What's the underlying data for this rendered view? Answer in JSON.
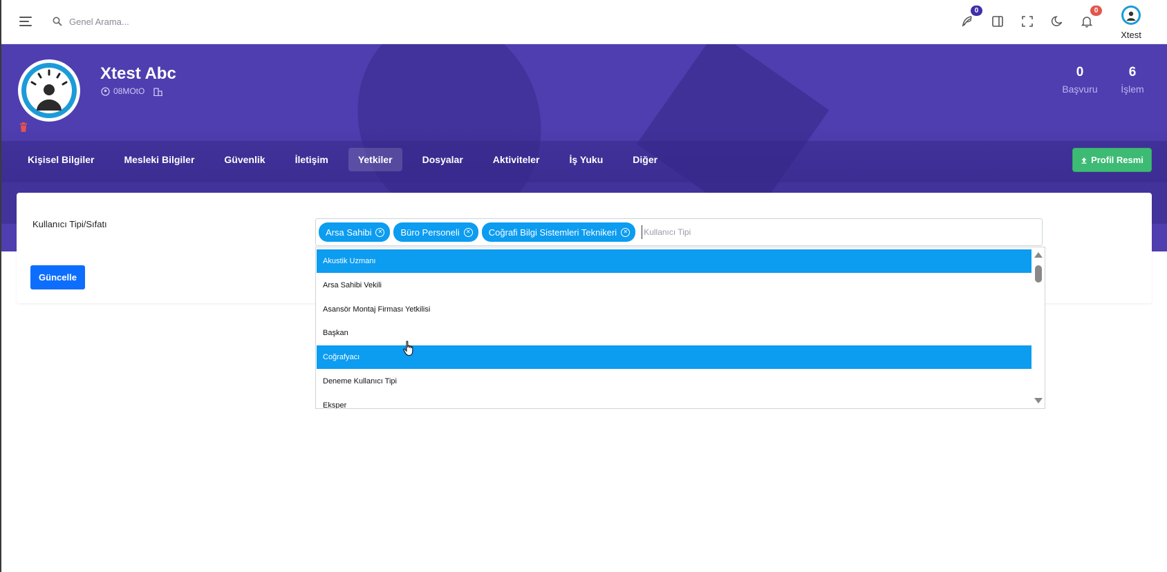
{
  "topbar": {
    "search_placeholder": "Genel Arama...",
    "messages_badge": "0",
    "notifications_badge": "0",
    "user_name": "Xtest"
  },
  "profile": {
    "name": "Xtest Abc",
    "code": "08MOtO",
    "stats": [
      {
        "value": "0",
        "label": "Başvuru"
      },
      {
        "value": "6",
        "label": "İşlem"
      }
    ]
  },
  "tabs": [
    {
      "label": "Kişisel Bilgiler"
    },
    {
      "label": "Mesleki Bilgiler"
    },
    {
      "label": "Güvenlik"
    },
    {
      "label": "İletişim"
    },
    {
      "label": "Yetkiler"
    },
    {
      "label": "Dosyalar"
    },
    {
      "label": "Aktiviteler"
    },
    {
      "label": "İş Yuku"
    },
    {
      "label": "Diğer"
    }
  ],
  "active_tab": "Yetkiler",
  "profile_button": "Profil Resmi",
  "form": {
    "label": "Kullanıcı Tipi/Sıfatı",
    "selected": [
      "Arsa Sahibi",
      "Büro Personeli",
      "Coğrafi Bilgi Sistemleri Teknikeri"
    ],
    "placeholder": "Kullanıcı Tipi",
    "options": [
      {
        "label": "Akustik Uzmanı",
        "highlighted": true
      },
      {
        "label": "Arsa Sahibi Vekili",
        "highlighted": false
      },
      {
        "label": "Asansör Montaj Firması Yetkilisi",
        "highlighted": false
      },
      {
        "label": "Başkan",
        "highlighted": false
      },
      {
        "label": "Coğrafyacı",
        "highlighted": true
      },
      {
        "label": "Deneme Kullanıcı Tipi",
        "highlighted": false
      },
      {
        "label": "Eksper",
        "highlighted": false
      }
    ],
    "submit_label": "Güncelle"
  },
  "colors": {
    "hero": "#4f3eb0",
    "primary": "#0d6efd",
    "success": "#3dbb75",
    "chip": "#0c9cf0",
    "badge_messages": "#3f2fa8",
    "badge_notifications": "#e2574c"
  }
}
